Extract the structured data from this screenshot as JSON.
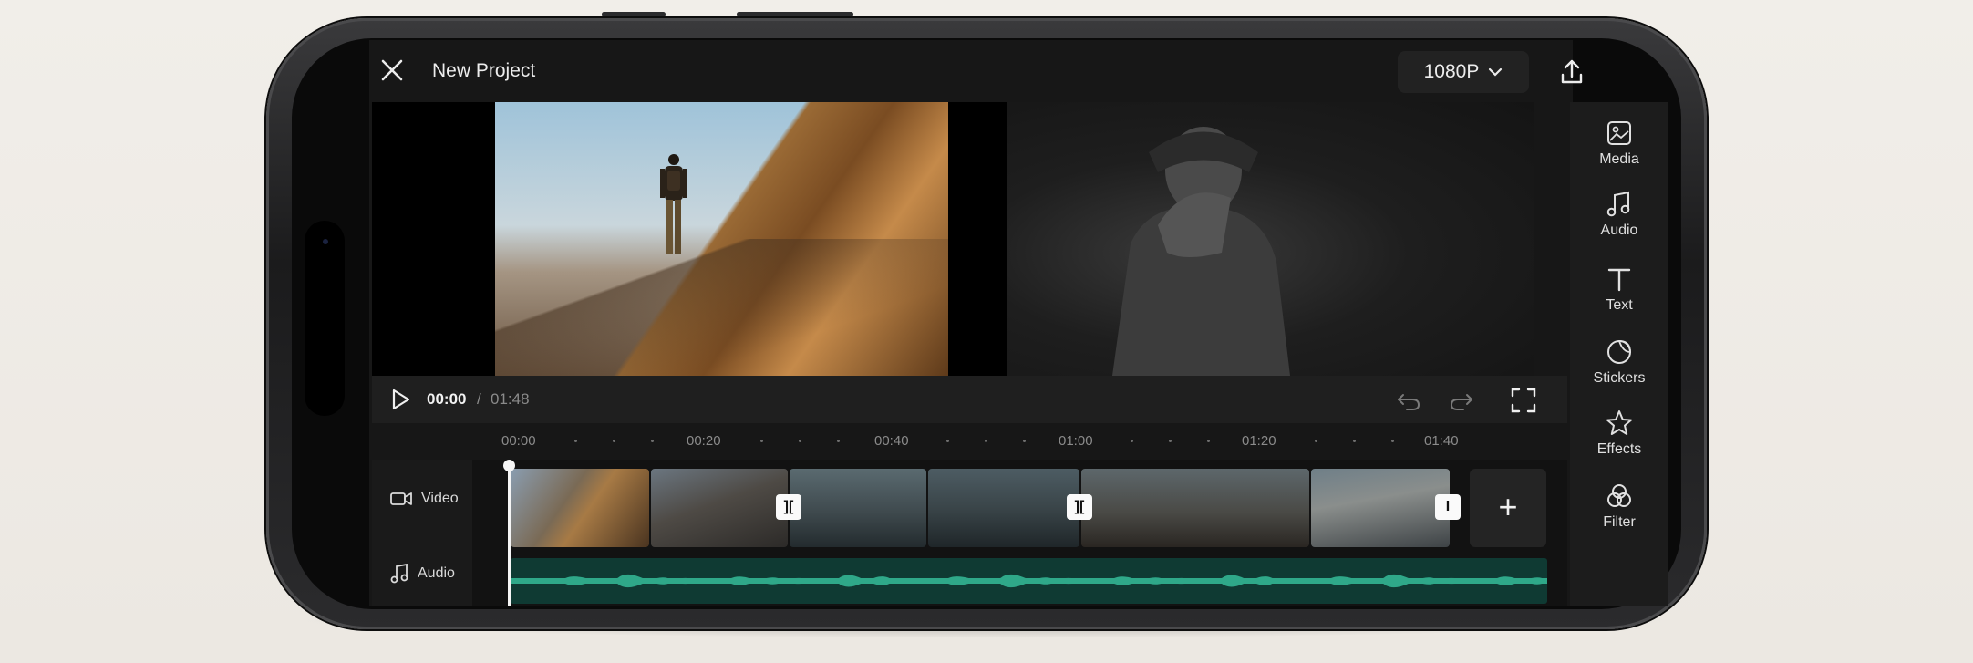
{
  "header": {
    "title": "New Project",
    "resolution": "1080P",
    "close_icon": "close-icon",
    "export_icon": "upload-icon"
  },
  "player": {
    "current_time": "00:00",
    "separator": "/",
    "total_time": "01:48"
  },
  "ruler": {
    "ticks": [
      "00:00",
      "00:20",
      "00:40",
      "01:00",
      "01:20",
      "01:40"
    ]
  },
  "tracks": {
    "video_label": "Video",
    "audio_label": "Audio",
    "transitions": [
      "][",
      "][",
      "I"
    ],
    "add_label": "+"
  },
  "tools": [
    {
      "label": "Media",
      "icon": "media-icon"
    },
    {
      "label": "Audio",
      "icon": "music-note-icon"
    },
    {
      "label": "Text",
      "icon": "text-icon"
    },
    {
      "label": "Stickers",
      "icon": "sticker-icon"
    },
    {
      "label": "Effects",
      "icon": "star-icon"
    },
    {
      "label": "Filter",
      "icon": "filter-icon"
    }
  ],
  "colors": {
    "background": "#171717",
    "audio_wave": "#2fa889",
    "accent": "#ffffff"
  }
}
